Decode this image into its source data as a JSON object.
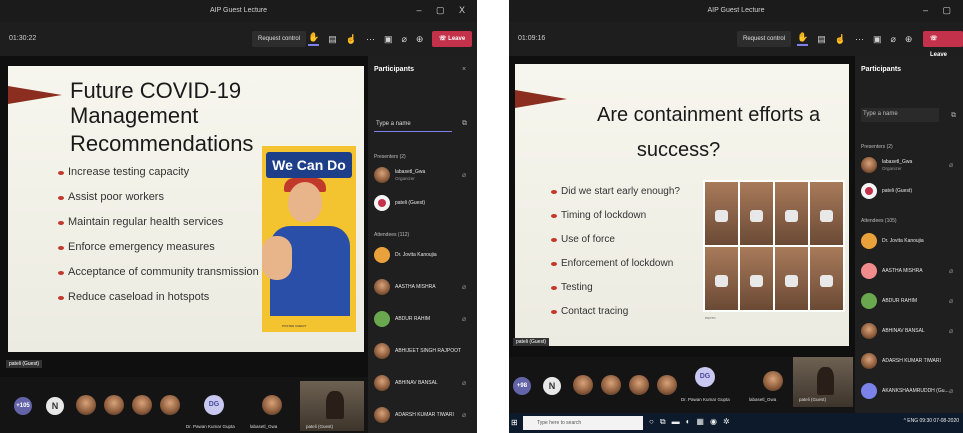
{
  "left": {
    "window_title": "AIP Guest Lecture",
    "window_controls": "– ▢ X",
    "timer": "01:30:22",
    "request_control": "Request control",
    "leave": "Leave",
    "slide": {
      "title_line1": "Future COVID-19 Management",
      "title_line2": "Recommendations",
      "bullets": [
        "Increase testing capacity",
        "Assist poor workers",
        "Maintain regular health services",
        "Enforce emergency measures",
        "Acceptance of community transmission",
        "Reduce caseload in hotspots"
      ],
      "poster_text": "We Can Do It!",
      "poster_credit": "POSTER CREDIT"
    },
    "presenter_tag": "pateli (Guest)",
    "participants": {
      "title": "Participants",
      "search_placeholder": "Type a name",
      "presenters_header": "Presenters (2)",
      "attendees_header": "Attendees (112)",
      "presenters": [
        {
          "name": "labasetl_Gwa",
          "role": "Organizer"
        },
        {
          "name": "pateli (Guest)",
          "role": ""
        }
      ],
      "attendees": [
        "Dr. Jovita Kanoujia",
        "AASTHA MISHRA",
        "ABDUR RAHIM",
        "ABHIJEET SINGH RAJPOOT",
        "ABHINAV BANSAL",
        "ADARSH KUMAR TIWARI"
      ]
    },
    "video_strip": {
      "count_badge": "+105",
      "letter_avatar": "N",
      "dg_avatar": "DG",
      "names": [
        "Dr. Pawan Kumar Gupta",
        "labasetl_Gwa",
        "pateli (Guest)"
      ]
    }
  },
  "right": {
    "window_title": "AIP Guest Lecture",
    "window_controls": "– ▢",
    "timer": "01:09:16",
    "request_control": "Request control",
    "leave": "Leave",
    "slide": {
      "title_line1": "Are containment efforts a",
      "title_line2": "success?",
      "bullets": [
        "Did we start early enough?",
        "Timing of lockdown",
        "Use of force",
        "Enforcement of lockdown",
        "Testing",
        "Contact tracing"
      ],
      "photo_credit": "PHOTO"
    },
    "presenter_tag": "pateli (Guest)",
    "participants": {
      "title": "Participants",
      "search_placeholder": "Type a name",
      "presenters_header": "Presenters (2)",
      "attendees_header": "Attendees (105)",
      "presenters": [
        {
          "name": "labasetl_Gwa",
          "role": "Organizer"
        },
        {
          "name": "pateli (Guest)",
          "role": ""
        }
      ],
      "attendees": [
        "Dr. Jovita Kanoujia",
        "AASTHA MISHRA",
        "ABDUR RAHIM",
        "ABHINAV BANSAL",
        "ADARSH KUMAR TIWARI",
        "AKANKSHAAMRUDDH (Gu..."
      ]
    },
    "video_strip": {
      "count_badge": "+98",
      "letter_avatar": "N",
      "dg_avatar": "DG",
      "names": [
        "Dr. Pawan Kumar Gupta",
        "labasetl_Gwa",
        "pateli (Guest)"
      ]
    },
    "taskbar": {
      "search_placeholder": "Type here to search",
      "tray": "^ ENG 09:30 07-08-2020"
    }
  }
}
